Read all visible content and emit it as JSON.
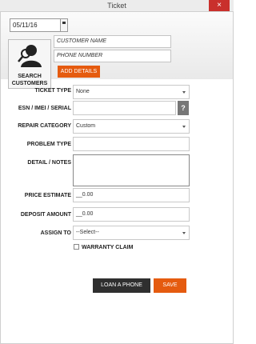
{
  "window": {
    "title": "Ticket",
    "close_icon": "×"
  },
  "header": {
    "date": "05/11/16",
    "search_button_label_line1": "SEARCH",
    "search_button_label_line2": "CUSTOMERS",
    "customer_name_placeholder": "CUSTOMER NAME",
    "phone_placeholder": "PHONE NUMBER",
    "add_details_label": "ADD DETAILS"
  },
  "form": {
    "ticket_type": {
      "label": "TICKET TYPE",
      "value": "None"
    },
    "esn": {
      "label": "ESN / IMEI / SERIAL",
      "value": "",
      "help": "?"
    },
    "repair_category": {
      "label": "REPAIR CATEGORY",
      "value": "Custom"
    },
    "problem_type": {
      "label": "PROBLEM TYPE",
      "value": ""
    },
    "detail_notes": {
      "label": "DETAIL / NOTES",
      "value": ""
    },
    "price_estimate": {
      "label": "PRICE ESTIMATE",
      "value": "__0.00"
    },
    "deposit_amount": {
      "label": "DEPOSIT AMOUNT",
      "value": "__0.00"
    },
    "assign_to": {
      "label": "ASSIGN TO",
      "value": "--Select--"
    },
    "warranty_claim": {
      "label": "WARRANTY CLAIM"
    }
  },
  "actions": {
    "loan_phone": "LOAN A PHONE",
    "save": "SAVE"
  },
  "colors": {
    "accent": "#e55b0f",
    "dark_button": "#2f2f2f",
    "close": "#c9302c"
  }
}
